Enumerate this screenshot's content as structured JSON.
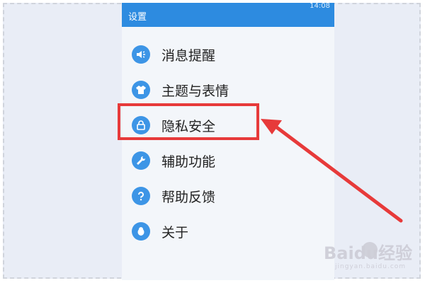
{
  "header": {
    "title": "设置",
    "time": "14:08"
  },
  "menu": {
    "items": [
      {
        "label": "消息提醒",
        "icon": "speaker-icon"
      },
      {
        "label": "主题与表情",
        "icon": "tshirt-icon"
      },
      {
        "label": "隐私安全",
        "icon": "lock-icon"
      },
      {
        "label": "辅助功能",
        "icon": "wrench-icon"
      },
      {
        "label": "帮助反馈",
        "icon": "question-icon"
      },
      {
        "label": "关于",
        "icon": "penguin-icon"
      }
    ]
  },
  "annotation": {
    "highlight_color": "#e73a3a",
    "highlighted_item": "隐私安全"
  },
  "watermark": {
    "logo": "Baidu经验",
    "subtitle": "jingyan.baidu.com"
  },
  "colors": {
    "header": "#2d8be0",
    "icon": "#3d95e6",
    "background": "#e9edf6"
  }
}
